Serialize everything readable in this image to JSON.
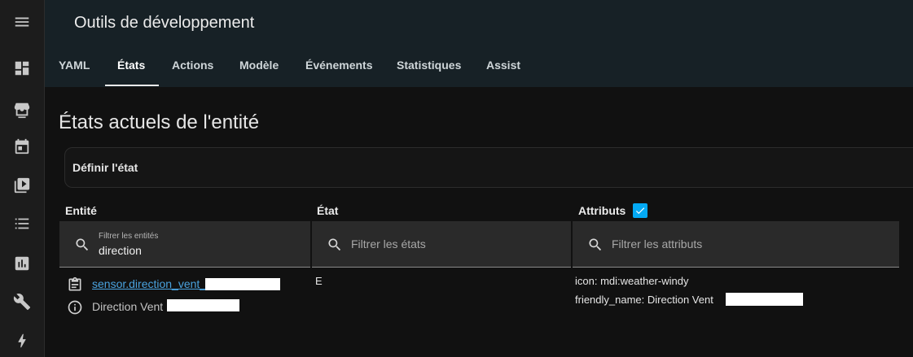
{
  "sidebar": {
    "icons": [
      "menu-icon",
      "dashboard-icon",
      "hacs-icon",
      "calendar-icon",
      "media-icon",
      "todo-list-icon",
      "energy-chart-icon",
      "wrench-icon",
      "lightning-icon"
    ],
    "hacs_label": "HACS"
  },
  "header": {
    "title": "Outils de développement",
    "tabs": [
      "YAML",
      "États",
      "Actions",
      "Modèle",
      "Événements",
      "Statistiques",
      "Assist"
    ],
    "active_tab": "États"
  },
  "main": {
    "page_title": "États actuels de l'entité",
    "set_state_label": "Définir l'état",
    "columns": {
      "entity": "Entité",
      "state": "État",
      "attributes": "Attributs"
    },
    "attributes_checked": true,
    "filters": {
      "entity_label": "Filtrer les entités",
      "entity_value": "direction",
      "state_placeholder": "Filtrer les états",
      "attributes_placeholder": "Filtrer les attributs"
    },
    "rows": [
      {
        "entity_id": "sensor.direction_vent_",
        "friendly_name": "Direction Vent",
        "state": "E",
        "attr_icon": "icon: mdi:weather-windy",
        "attr_friendly_name": "friendly_name: Direction Vent"
      }
    ]
  },
  "colors": {
    "header_bg": "#172126",
    "accent": "#03a9f4",
    "link": "#4aa3df"
  }
}
